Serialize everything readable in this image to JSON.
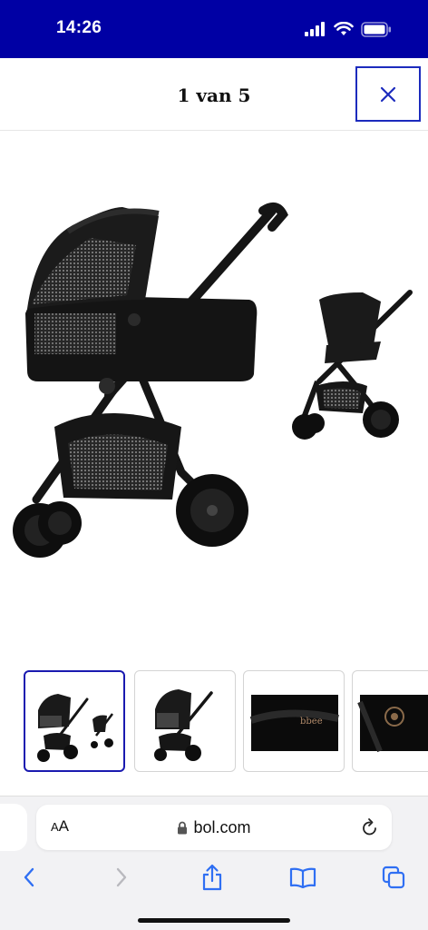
{
  "status_bar": {
    "time": "14:26",
    "background": "#0000a4"
  },
  "header": {
    "title": "1 van 5",
    "close_icon": "close-icon",
    "accent": "#1c2bbd"
  },
  "gallery": {
    "main_image": "black-pram-with-carrycot-and-seat-unit",
    "thumbnails": [
      {
        "name": "pram-carrycot-and-seat",
        "active": true
      },
      {
        "name": "pram-carrycot",
        "active": false
      },
      {
        "name": "closeup-logo",
        "active": false,
        "text": "bbee"
      },
      {
        "name": "closeup-emblem",
        "active": false
      }
    ]
  },
  "safari": {
    "text_size_label_small": "A",
    "text_size_label_large": "A",
    "url": "bol.com",
    "toolbar_icons": [
      "back-icon",
      "forward-icon",
      "share-icon",
      "bookmarks-icon",
      "tabs-icon"
    ]
  }
}
